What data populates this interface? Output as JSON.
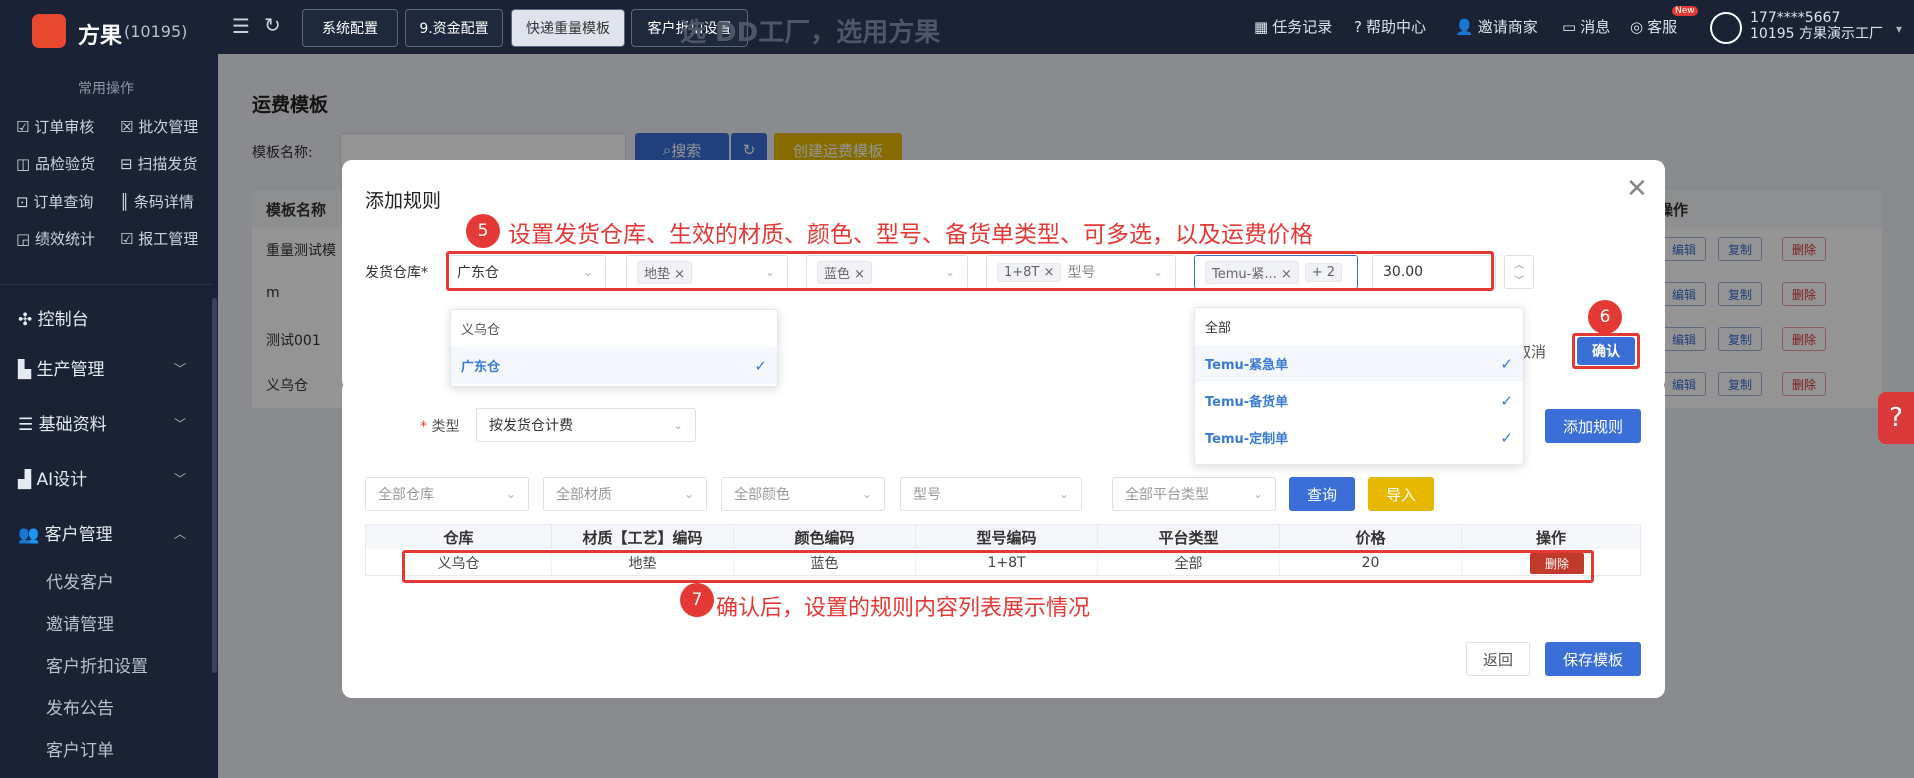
{
  "app": {
    "logo_text": "方果",
    "logo_id": "(10195)",
    "banner": "选 DD工厂，选用方果"
  },
  "top_tabs": [
    "系统配置",
    "9.资金配置",
    "快递重量模板",
    "客户折扣设置"
  ],
  "top_right": {
    "tasks": "任务记录",
    "help": "帮助中心",
    "invite": "邀请商家",
    "messages": "消息",
    "service": "客服",
    "new_badge": "New",
    "user_phone": "177****5667",
    "user_company": "10195 方果演示工厂"
  },
  "sidebar": {
    "section_title": "常用操作",
    "quick": [
      [
        "订单审核",
        "批次管理"
      ],
      [
        "品检验货",
        "扫描发货"
      ],
      [
        "订单查询",
        "条码详情"
      ],
      [
        "绩效统计",
        "报工管理"
      ]
    ],
    "menus": [
      "控制台",
      "生产管理",
      "基础资料",
      "AI设计",
      "客户管理"
    ],
    "sub_items": [
      "代发客户",
      "邀请管理",
      "客户折扣设置",
      "发布公告",
      "客户订单"
    ]
  },
  "page": {
    "title": "运费模板",
    "name_label": "模板名称:",
    "search": "搜索",
    "create": "创建运费模板",
    "table_head": "模板名称",
    "ops_head": "操作",
    "rows": [
      "重量测试模",
      "m",
      "测试001",
      "义乌仓"
    ],
    "row_buttons": {
      "edit": "编辑",
      "copy": "复制",
      "delete": "删除"
    }
  },
  "bg_modal": {
    "type_label": "类型",
    "type_value": "按发货仓计费",
    "add_rule": "添加规则",
    "filters": [
      "全部仓库",
      "全部材质",
      "全部颜色",
      "型号",
      "全部平台类型"
    ],
    "query": "查询",
    "import": "导入",
    "columns": [
      "仓库",
      "材质【工艺】编码",
      "颜色编码",
      "型号编码",
      "平台类型",
      "价格",
      "操作"
    ],
    "row": [
      "义乌仓",
      "地垫",
      "蓝色",
      "1+8T",
      "全部",
      "20",
      "删除"
    ],
    "back": "返回",
    "save": "保存模板"
  },
  "dialog": {
    "title": "添加规则",
    "warehouse_label": "发货仓库*",
    "warehouse_value": "广东仓",
    "material_tag": "地垫",
    "color_tag": "蓝色",
    "model_tag": "1+8T",
    "model_placeholder": "型号",
    "order_tag": "Temu-紧...",
    "order_more": "+ 2",
    "price": "30.00",
    "cancel": "取消",
    "confirm": "确认",
    "warehouse_options": [
      "义乌仓",
      "广东仓"
    ],
    "order_options": [
      "全部",
      "Temu-紧急单",
      "Temu-备货单",
      "Temu-定制单"
    ]
  },
  "annotations": {
    "step5_num": "5",
    "step5_text": "设置发货仓库、生效的材质、颜色、型号、备货单类型、可多选，以及运费价格",
    "step6_num": "6",
    "step7_num": "7",
    "step7_text": "确认后，设置的规则内容列表展示情况"
  },
  "colors": {
    "primary": "#3a6fd8",
    "annotation": "#e53935",
    "nav_bg": "#1a2336",
    "logo": "#e8492e"
  }
}
